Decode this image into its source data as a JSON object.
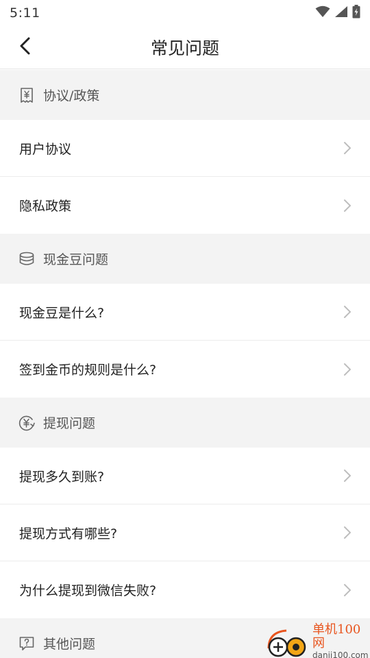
{
  "status_bar": {
    "time": "5:11"
  },
  "nav": {
    "title": "常见问题"
  },
  "sections": [
    {
      "title": "协议/政策",
      "icon": "receipt-yen-icon",
      "items": [
        "用户协议",
        "隐私政策"
      ]
    },
    {
      "title": "现金豆问题",
      "icon": "coin-stack-icon",
      "items": [
        "现金豆是什么?",
        "签到金币的规则是什么?"
      ]
    },
    {
      "title": "提现问题",
      "icon": "yen-exchange-icon",
      "items": [
        "提现多久到账?",
        "提现方式有哪些?",
        "为什么提现到微信失败?"
      ]
    },
    {
      "title": "其他问题",
      "icon": "question-bubble-icon",
      "items": []
    }
  ],
  "watermark": {
    "name": "单机100网",
    "url": "danji100.com"
  },
  "colors": {
    "section_bg": "#f3f3f3",
    "chevron": "#bdbdbd",
    "watermark_accent": "#e8551f"
  }
}
